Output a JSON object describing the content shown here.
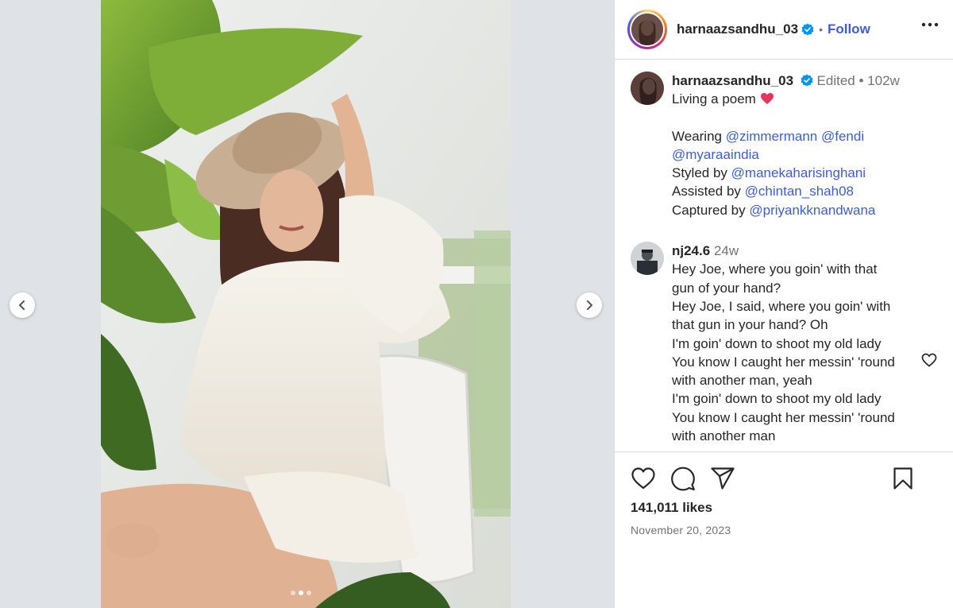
{
  "post": {
    "username": "harnaazsandhu_03",
    "follow_label": "Follow",
    "separator": "•"
  },
  "caption": {
    "username": "harnaazsandhu_03",
    "edited": "Edited",
    "separator": "•",
    "age": "102w",
    "line1": "Living a poem",
    "wearing_prefix": "Wearing",
    "mention_1": "@zimmermann",
    "mention_2": "@fendi",
    "mention_3": "@myaraaindia",
    "styled_prefix": "Styled by",
    "mention_4": "@manekaharisinghani",
    "assisted_prefix": "Assisted by",
    "mention_5": "@chintan_shah08",
    "captured_prefix": "Captured by",
    "mention_6": "@priyankknandwana"
  },
  "comment": {
    "username": "nj24.6",
    "age": "24w",
    "lines": [
      "Hey Joe, where you goin' with that",
      "gun of your hand?",
      "Hey Joe, I said, where you goin' with",
      "that gun in your hand? Oh",
      "I'm goin' down to shoot my old lady",
      "You know I caught her messin' 'round",
      "with another man, yeah",
      "I'm goin' down to shoot my old lady",
      "You know I caught her messin' 'round",
      "with another man"
    ]
  },
  "footer": {
    "likes": "141,011 likes",
    "date": "November 20, 2023"
  },
  "carousel": {
    "current": 2,
    "total": 3
  },
  "colors": {
    "accent": "#3d5dd8",
    "verified": "#0095f6",
    "heart_emoji": "#e8335a"
  }
}
